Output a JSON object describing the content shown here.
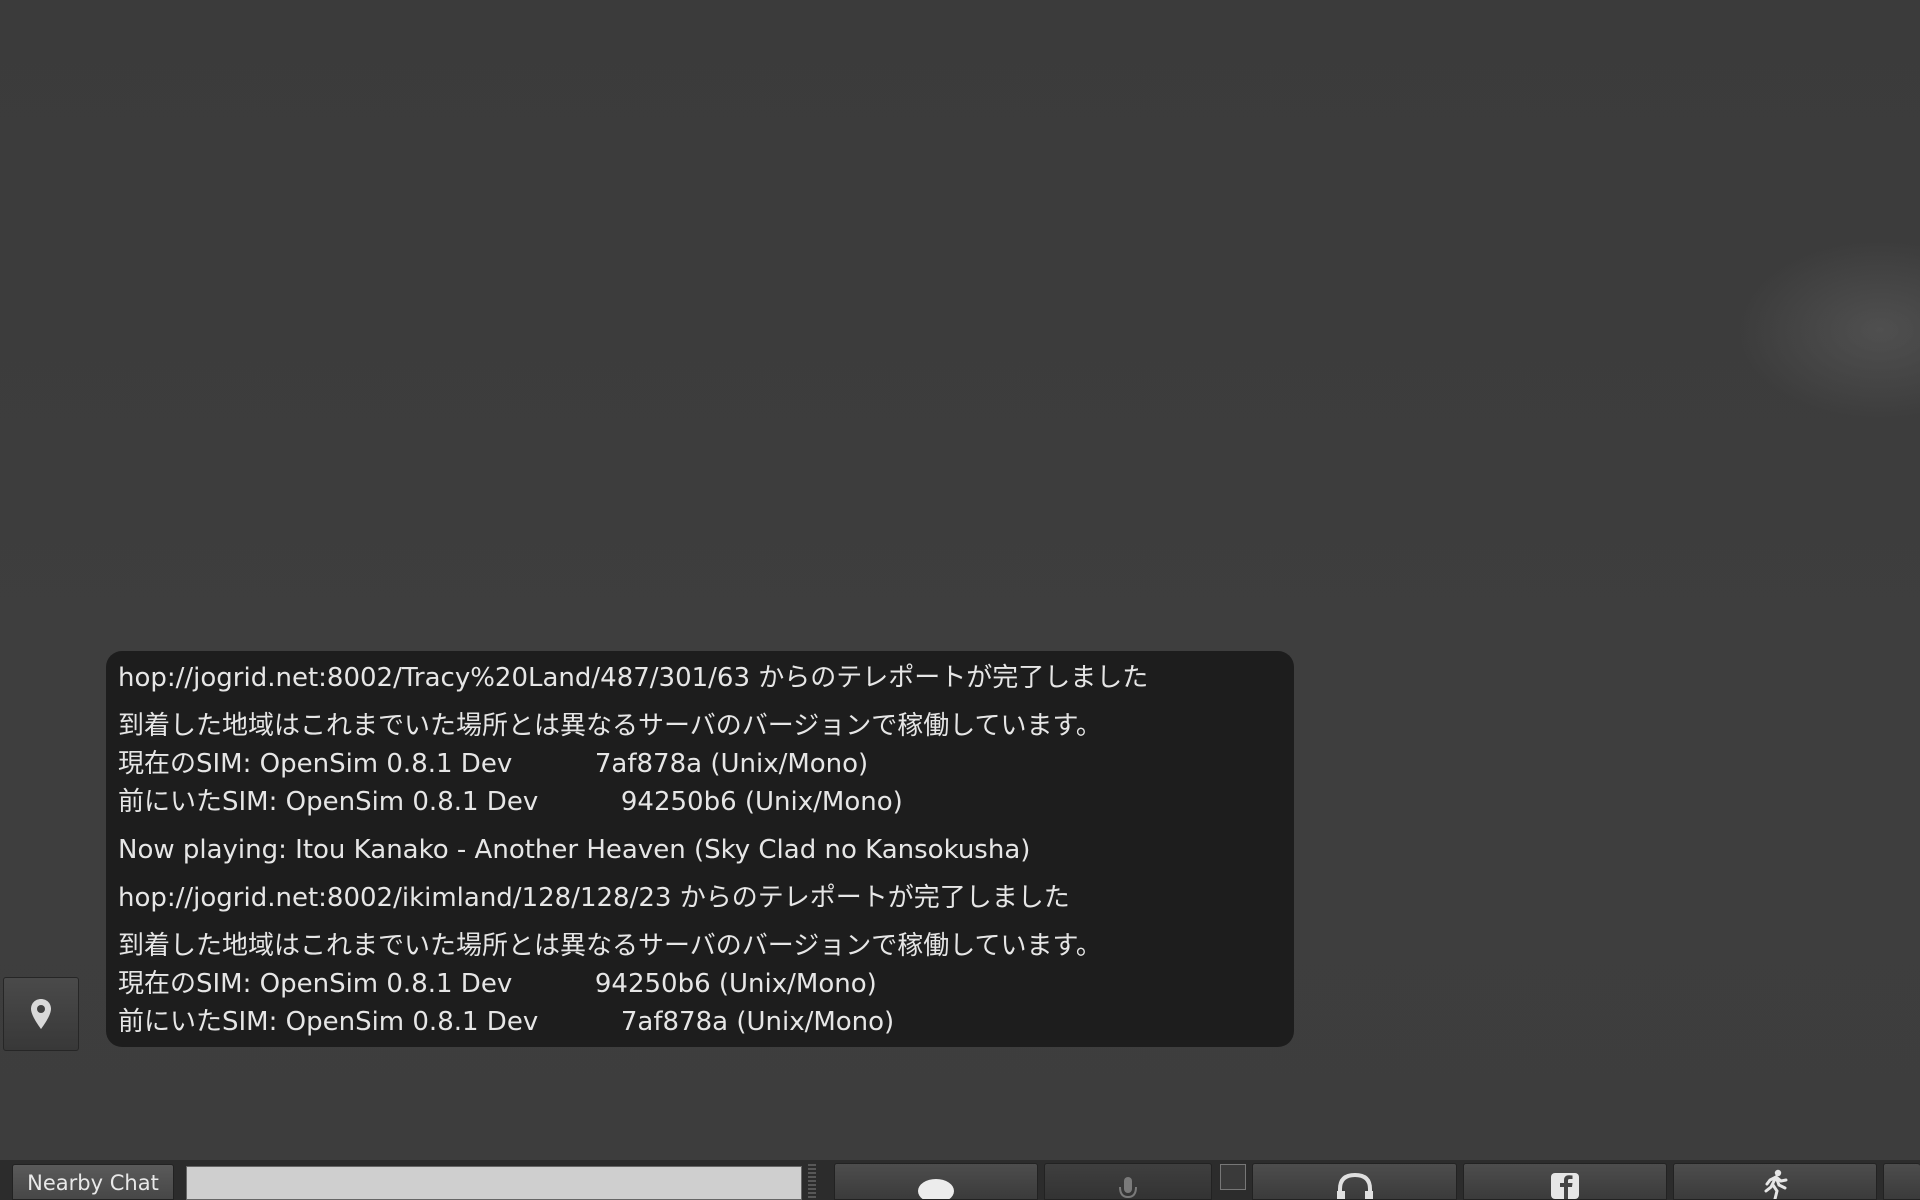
{
  "chat_toast": {
    "lines": [
      "hop://jogrid.net:8002/Tracy%20Land/487/301/63 からのテレポートが完了しました",
      "到着した地域はこれまでいた場所とは異なるサーバのバージョンで稼働しています。",
      "現在のSIM: OpenSim 0.8.1 Dev          7af878a (Unix/Mono)",
      "前にいたSIM: OpenSim 0.8.1 Dev          94250b6 (Unix/Mono)",
      "Now playing: Itou Kanako - Another Heaven (Sky Clad no Kansokusha)",
      "hop://jogrid.net:8002/ikimland/128/128/23 からのテレポートが完了しました",
      "到着した地域はこれまでいた場所とは異なるサーバのバージョンで稼働しています。",
      "現在のSIM: OpenSim 0.8.1 Dev          94250b6 (Unix/Mono)",
      "前にいたSIM: OpenSim 0.8.1 Dev          7af878a (Unix/Mono)"
    ]
  },
  "bottombar": {
    "nearby_chat_label": "Nearby Chat",
    "chat_input_value": "",
    "chat_input_placeholder": "",
    "buttons": [
      {
        "name": "chat",
        "icon": "speech-bubble-icon"
      },
      {
        "name": "speak",
        "icon": "microphone-icon"
      },
      {
        "name": "voice",
        "icon": "headphones-icon"
      },
      {
        "name": "facebook",
        "icon": "facebook-icon"
      },
      {
        "name": "move",
        "icon": "walking-person-icon"
      }
    ]
  },
  "location_button": {
    "icon": "location-pin-icon"
  },
  "colors": {
    "viewport_bg": "#3d3d3d",
    "toast_bg": "#1c1c1c",
    "toast_text": "#e6e6e6",
    "toolbar_bg": "#2c2c2c"
  }
}
